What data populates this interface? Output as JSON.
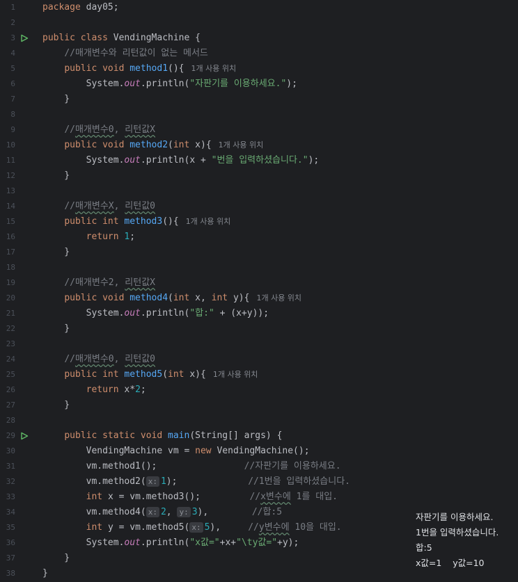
{
  "lines": [
    {
      "n": "1",
      "t": [
        [
          "kw",
          "package "
        ],
        [
          "",
          "day05;"
        ]
      ]
    },
    {
      "n": "2",
      "t": []
    },
    {
      "n": "3",
      "run": true,
      "t": [
        [
          "kw",
          "public class "
        ],
        [
          "",
          "VendingMachine {"
        ]
      ]
    },
    {
      "n": "4",
      "t": [
        [
          "",
          "    "
        ],
        [
          "cm",
          "//매개변수와 리턴값이 없는 메서드"
        ]
      ]
    },
    {
      "n": "5",
      "t": [
        [
          "",
          "    "
        ],
        [
          "kw",
          "public void "
        ],
        [
          "fn",
          "method1"
        ],
        [
          "",
          "(){"
        ],
        [
          "hint",
          "1개 사용 위치"
        ]
      ]
    },
    {
      "n": "6",
      "t": [
        [
          "",
          "        System."
        ],
        [
          "fld",
          "out"
        ],
        [
          "",
          ".println("
        ],
        [
          "str",
          "\"자판기를 이용하세요.\""
        ],
        [
          "",
          ");"
        ]
      ]
    },
    {
      "n": "7",
      "t": [
        [
          "",
          "    }"
        ]
      ]
    },
    {
      "n": "8",
      "t": []
    },
    {
      "n": "9",
      "t": [
        [
          "",
          "    "
        ],
        [
          "cm",
          "//"
        ],
        [
          "cmw",
          "매개변수0"
        ],
        [
          "cm",
          ", "
        ],
        [
          "cmw",
          "리턴값X"
        ]
      ]
    },
    {
      "n": "10",
      "t": [
        [
          "",
          "    "
        ],
        [
          "kw",
          "public void "
        ],
        [
          "fn",
          "method2"
        ],
        [
          "",
          "("
        ],
        [
          "kw",
          "int "
        ],
        [
          "",
          "x){"
        ],
        [
          "hint",
          "1개 사용 위치"
        ]
      ]
    },
    {
      "n": "11",
      "t": [
        [
          "",
          "        System."
        ],
        [
          "fld",
          "out"
        ],
        [
          "",
          ".println(x + "
        ],
        [
          "str",
          "\"번을 입력하셨습니다.\""
        ],
        [
          "",
          ");"
        ]
      ]
    },
    {
      "n": "12",
      "t": [
        [
          "",
          "    }"
        ]
      ]
    },
    {
      "n": "13",
      "t": []
    },
    {
      "n": "14",
      "t": [
        [
          "",
          "    "
        ],
        [
          "cm",
          "//"
        ],
        [
          "cmw",
          "매개변수X"
        ],
        [
          "cm",
          ", "
        ],
        [
          "cmw",
          "리턴값0"
        ]
      ]
    },
    {
      "n": "15",
      "t": [
        [
          "",
          "    "
        ],
        [
          "kw",
          "public int "
        ],
        [
          "fn",
          "method3"
        ],
        [
          "",
          "(){"
        ],
        [
          "hint",
          "1개 사용 위치"
        ]
      ]
    },
    {
      "n": "16",
      "t": [
        [
          "",
          "        "
        ],
        [
          "kw",
          "return "
        ],
        [
          "num",
          "1"
        ],
        [
          "",
          ";"
        ]
      ]
    },
    {
      "n": "17",
      "t": [
        [
          "",
          "    }"
        ]
      ]
    },
    {
      "n": "18",
      "t": []
    },
    {
      "n": "19",
      "t": [
        [
          "",
          "    "
        ],
        [
          "cm",
          "//매개변수2, "
        ],
        [
          "cmw",
          "리턴값X"
        ]
      ]
    },
    {
      "n": "20",
      "t": [
        [
          "",
          "    "
        ],
        [
          "kw",
          "public void "
        ],
        [
          "fn",
          "method4"
        ],
        [
          "",
          "("
        ],
        [
          "kw",
          "int "
        ],
        [
          "",
          "x, "
        ],
        [
          "kw",
          "int "
        ],
        [
          "",
          "y){"
        ],
        [
          "hint",
          "1개 사용 위치"
        ]
      ]
    },
    {
      "n": "21",
      "t": [
        [
          "",
          "        System."
        ],
        [
          "fld",
          "out"
        ],
        [
          "",
          ".println("
        ],
        [
          "str",
          "\"합:\""
        ],
        [
          "",
          " + (x+y));"
        ]
      ]
    },
    {
      "n": "22",
      "t": [
        [
          "",
          "    }"
        ]
      ]
    },
    {
      "n": "23",
      "t": []
    },
    {
      "n": "24",
      "t": [
        [
          "",
          "    "
        ],
        [
          "cm",
          "//"
        ],
        [
          "cmw",
          "매개변수0"
        ],
        [
          "cm",
          ", "
        ],
        [
          "cmw",
          "리턴값0"
        ]
      ]
    },
    {
      "n": "25",
      "t": [
        [
          "",
          "    "
        ],
        [
          "kw",
          "public int "
        ],
        [
          "fn",
          "method5"
        ],
        [
          "",
          "("
        ],
        [
          "kw",
          "int "
        ],
        [
          "",
          "x){"
        ],
        [
          "hint",
          "1개 사용 위치"
        ]
      ]
    },
    {
      "n": "26",
      "t": [
        [
          "",
          "        "
        ],
        [
          "kw",
          "return "
        ],
        [
          "",
          "x*"
        ],
        [
          "num",
          "2"
        ],
        [
          "",
          ";"
        ]
      ]
    },
    {
      "n": "27",
      "t": [
        [
          "",
          "    }"
        ]
      ]
    },
    {
      "n": "28",
      "t": []
    },
    {
      "n": "29",
      "run": true,
      "t": [
        [
          "",
          "    "
        ],
        [
          "kw",
          "public static void "
        ],
        [
          "fn",
          "main"
        ],
        [
          "",
          "(String[] args) {"
        ]
      ]
    },
    {
      "n": "30",
      "t": [
        [
          "",
          "        VendingMachine vm = "
        ],
        [
          "kw",
          "new "
        ],
        [
          "",
          "VendingMachine();"
        ]
      ]
    },
    {
      "n": "31",
      "t": [
        [
          "",
          "        vm.method1();                "
        ],
        [
          "cm",
          "//자판기를 이용하세요."
        ]
      ]
    },
    {
      "n": "32",
      "t": [
        [
          "",
          "        vm.method2("
        ],
        [
          "phint",
          "x:"
        ],
        [
          "num",
          "1"
        ],
        [
          "",
          ");             "
        ],
        [
          "cm",
          "//1번을 입력하셨습니다."
        ]
      ]
    },
    {
      "n": "33",
      "t": [
        [
          "",
          "        "
        ],
        [
          "kw",
          "int "
        ],
        [
          "",
          "x = vm.method3();         "
        ],
        [
          "cm",
          "//"
        ],
        [
          "cmw",
          "x변수에"
        ],
        [
          "cm",
          " 1를 대입."
        ]
      ]
    },
    {
      "n": "34",
      "t": [
        [
          "",
          "        vm.method4("
        ],
        [
          "phint",
          "x:"
        ],
        [
          "num",
          "2"
        ],
        [
          "",
          ", "
        ],
        [
          "phint",
          "y:"
        ],
        [
          "num",
          "3"
        ],
        [
          "",
          "),        "
        ],
        [
          "cm",
          "//합:5"
        ]
      ]
    },
    {
      "n": "35",
      "t": [
        [
          "",
          "        "
        ],
        [
          "kw",
          "int "
        ],
        [
          "",
          "y = vm.method5("
        ],
        [
          "phint",
          "x:"
        ],
        [
          "num",
          "5"
        ],
        [
          "",
          "),     "
        ],
        [
          "cm",
          "//"
        ],
        [
          "cmw",
          "y변수에"
        ],
        [
          "cm",
          " 10을 대입."
        ]
      ]
    },
    {
      "n": "36",
      "t": [
        [
          "",
          "        System."
        ],
        [
          "fld",
          "out"
        ],
        [
          "",
          ".println("
        ],
        [
          "str",
          "\"x값=\""
        ],
        [
          "",
          "+x+"
        ],
        [
          "str",
          "\"\\ty값=\""
        ],
        [
          "",
          "+y);"
        ]
      ]
    },
    {
      "n": "37",
      "t": [
        [
          "",
          "    }"
        ]
      ]
    },
    {
      "n": "38",
      "t": [
        [
          "",
          "}"
        ]
      ]
    }
  ],
  "console": [
    "자판기를 이용하세요.",
    "1번을 입력하셨습니다.",
    "합:5",
    "x값=1    y값=10"
  ],
  "colors": {
    "background": "#1e1f22",
    "keyword": "#cf8e6d",
    "string": "#6aab73",
    "number": "#2aacb8",
    "function": "#56a8f5",
    "field": "#c77dbb",
    "run_icon": "#5fb865"
  },
  "icons": {
    "run_gutter": "run-icon"
  }
}
